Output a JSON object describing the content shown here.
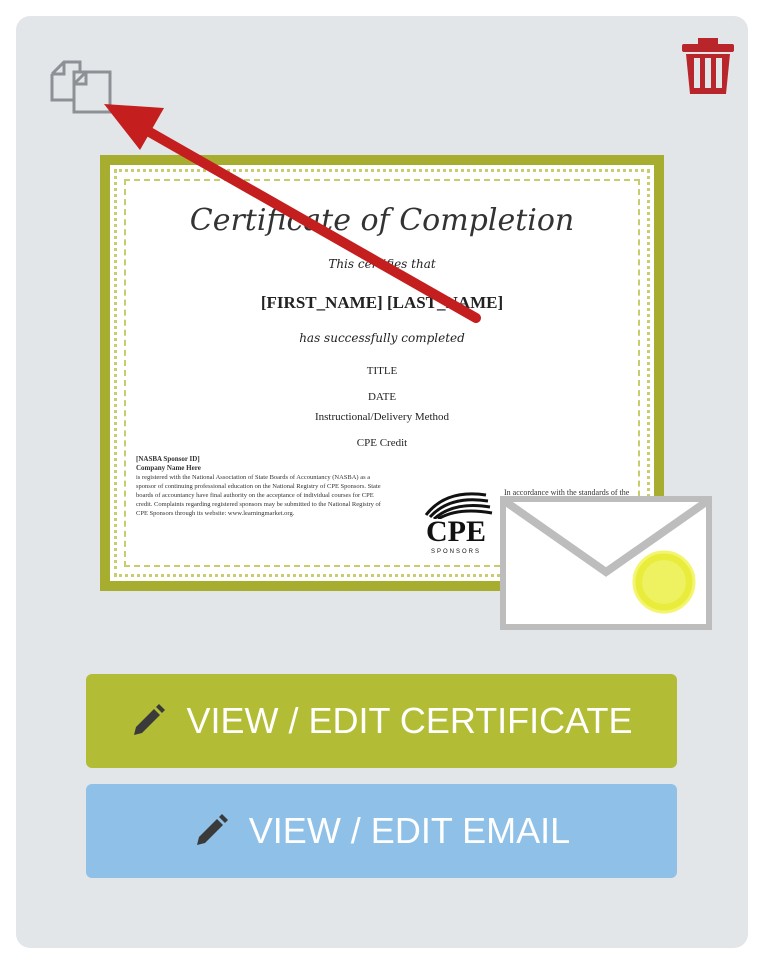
{
  "certificate": {
    "title": "Certificate of Completion",
    "certifies": "This certifies that",
    "name": "[FIRST_NAME] [LAST_NAME]",
    "completed": "has successfully completed",
    "field_title": "TITLE",
    "field_date": "DATE",
    "field_method": "Instructional/Delivery Method",
    "field_credit": "CPE Credit",
    "left_heading": "[NASBA Sponsor ID]",
    "left_company": "Company Name Here",
    "left_body": "is registered with the National Association of State Boards of Accountancy (NASBA) as a sponsor of continuing professional education on the National Registry of CPE Sponsors. State boards of accountancy have final authority on the acceptance of individual courses for CPE credit. Complaints regarding registered sponsors may be submitted to the National Registry of CPE Sponsors through its website: www.learningmarket.org.",
    "cpe_logo_text": "CPE",
    "cpe_logo_sub": "SPONSORS",
    "right_body": "In accordance with the standards of the National Registry of CPE Sponsors, CPE credits have been granted based on a 50-minute hour."
  },
  "buttons": {
    "view_edit_certificate": "VIEW / EDIT CERTIFICATE",
    "view_edit_email": "VIEW / EDIT EMAIL"
  },
  "icons": {
    "copy": "copy-icon",
    "trash": "trash-icon",
    "pencil": "pencil-icon",
    "envelope": "envelope-icon",
    "arrow": "arrow-annotation"
  },
  "colors": {
    "card_bg": "#e3e6e9",
    "certificate_button": "#b2bd35",
    "email_button": "#8fc0e8",
    "trash": "#b8262b",
    "arrow": "#c41e1e",
    "border_green": "#a6ad2f"
  }
}
